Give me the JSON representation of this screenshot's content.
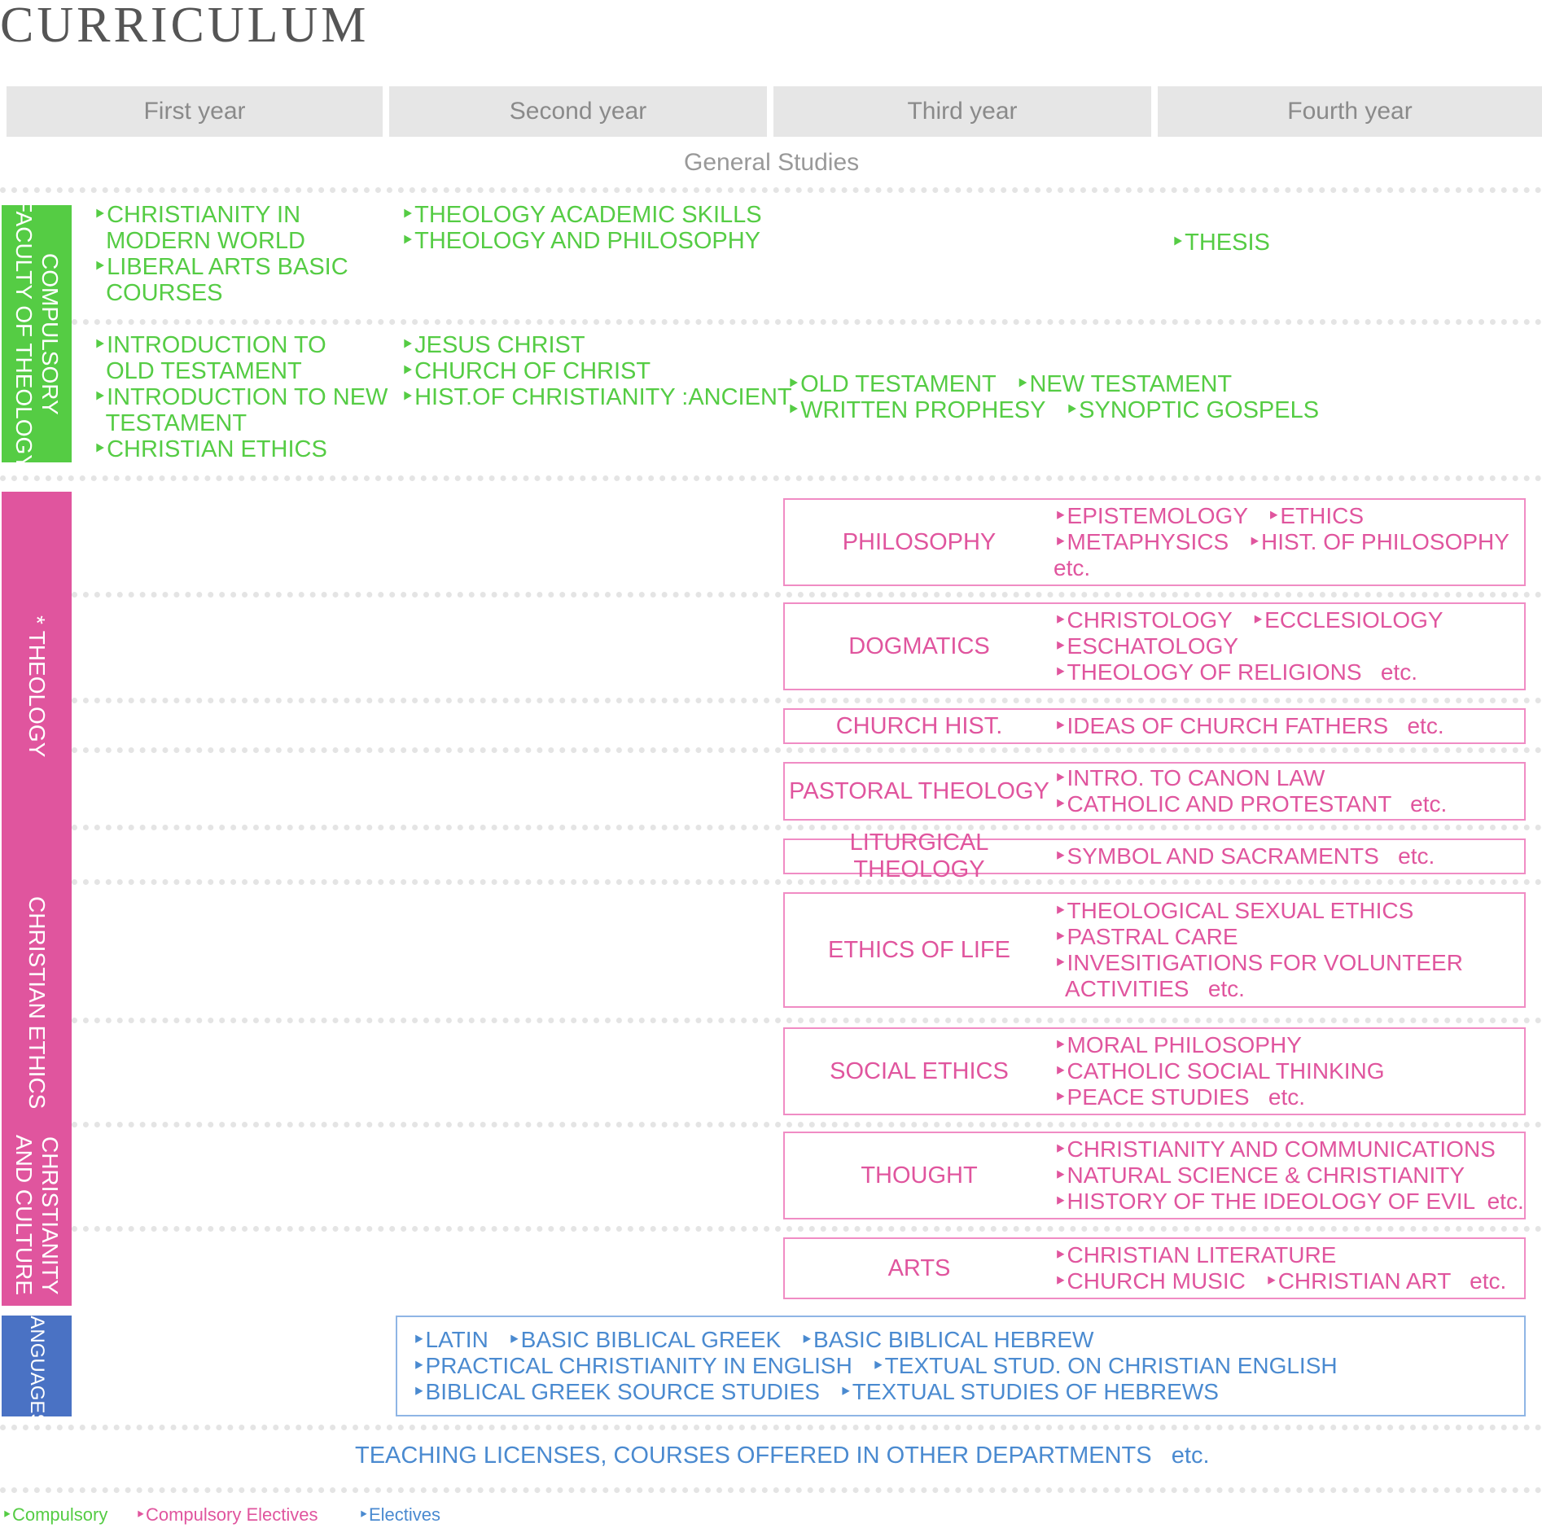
{
  "title": "CURRICULUM",
  "years": [
    "First year",
    "Second year",
    "Third year",
    "Fourth year"
  ],
  "general_studies_label": "General Studies",
  "sidebands": {
    "compulsory": "COMPULSORY\nFACULTY OF THEOLOGY",
    "theology": "THEOLOGY",
    "theology_mark": "*",
    "christian_ethics": "CHRISTIAN ETHICS",
    "christianity_culture": "CHRISTIANITY\nAND CULTURE",
    "languages": "LANGUAGES"
  },
  "compulsory": {
    "row1": {
      "year1": "‣CHRISTIANITY IN\n  MODERN WORLD\n‣LIBERAL ARTS BASIC\n  COURSES",
      "year2": "‣THEOLOGY ACADEMIC SKILLS\n‣THEOLOGY AND PHILOSOPHY",
      "year34": "‣THESIS"
    },
    "row2": {
      "year1": "‣INTRODUCTION TO\n  OLD TESTAMENT\n‣INTRODUCTION TO NEW\n  TESTAMENT\n‣CHRISTIAN ETHICS",
      "year2": "‣JESUS CHRIST\n‣CHURCH OF CHRIST\n‣HIST.OF CHRISTIANITY :ANCIENT",
      "year34": "‣OLD TESTAMENT   ‣NEW TESTAMENT\n‣WRITTEN PROPHESY   ‣SYNOPTIC GOSPELS"
    }
  },
  "elective_boxes": [
    {
      "name": "PHILOSOPHY",
      "items": "‣EPISTEMOLOGY   ‣ETHICS\n‣METAPHYSICS   ‣HIST. OF PHILOSOPHY\netc."
    },
    {
      "name": "DOGMATICS",
      "items": "‣CHRISTOLOGY   ‣ECCLESIOLOGY\n‣ESCHATOLOGY\n‣THEOLOGY OF RELIGIONS   etc."
    },
    {
      "name": "CHURCH HIST.",
      "items": "‣IDEAS OF CHURCH FATHERS   etc."
    },
    {
      "name": "PASTORAL THEOLOGY",
      "items": "‣INTRO. TO CANON LAW\n‣CATHOLIC AND PROTESTANT   etc."
    },
    {
      "name": "LITURGICAL THEOLOGY",
      "items": "‣SYMBOL AND SACRAMENTS   etc."
    },
    {
      "name": "ETHICS OF LIFE",
      "items": "‣THEOLOGICAL SEXUAL ETHICS\n‣PASTRAL CARE\n‣INVESITIGATIONS FOR VOLUNTEER\n  ACTIVITIES   etc."
    },
    {
      "name": "SOCIAL ETHICS",
      "items": "‣MORAL PHILOSOPHY\n‣CATHOLIC SOCIAL THINKING\n‣PEACE STUDIES   etc."
    },
    {
      "name": "THOUGHT",
      "items": "‣CHRISTIANITY AND COMMUNICATIONS\n‣NATURAL SCIENCE & CHRISTIANITY\n‣HISTORY OF THE IDEOLOGY OF EVIL  etc."
    },
    {
      "name": "ARTS",
      "items": "‣CHRISTIAN LITERATURE\n‣CHURCH MUSIC   ‣CHRISTIAN ART   etc."
    }
  ],
  "languages": "‣LATIN   ‣BASIC BIBLICAL GREEK   ‣BASIC BIBLICAL HEBREW\n‣PRACTICAL CHRISTIANITY IN ENGLISH   ‣TEXTUAL STUD. ON CHRISTIAN ENGLISH\n‣BIBLICAL GREEK SOURCE STUDIES   ‣TEXTUAL STUDIES OF HEBREWS",
  "other": "TEACHING LICENSES, COURSES OFFERED IN OTHER DEPARTMENTS   etc.",
  "legend": [
    "‣Compulsory",
    "‣Compulsory Electives",
    "‣Electives"
  ],
  "colors": {
    "compulsory": "#55cc44",
    "elective": "#e0559e",
    "language": "#4a8ad0",
    "header_bg": "#e6e6e6"
  }
}
